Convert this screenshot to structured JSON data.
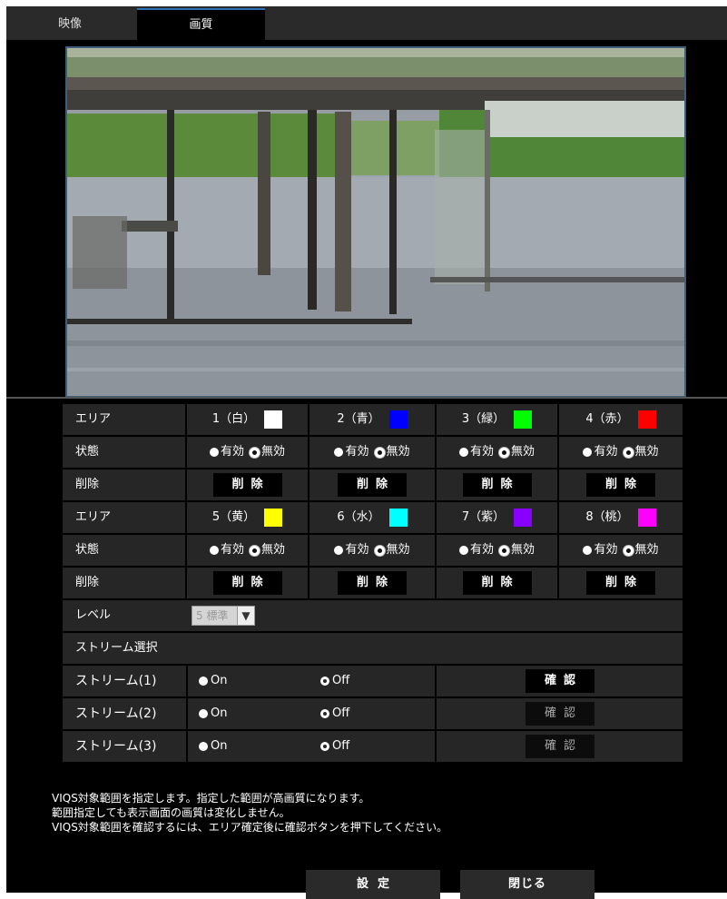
{
  "tabs": [
    {
      "label": "映像"
    },
    {
      "label": "画質"
    }
  ],
  "areas_row1": [
    {
      "label": "1（白）",
      "color": "#ffffff"
    },
    {
      "label": "2（青）",
      "color": "#0000ff"
    },
    {
      "label": "3（緑）",
      "color": "#00ff00"
    },
    {
      "label": "4（赤）",
      "color": "#ff0000"
    }
  ],
  "areas_row2": [
    {
      "label": "5（黄）",
      "color": "#ffff00"
    },
    {
      "label": "6（水）",
      "color": "#00ffff"
    },
    {
      "label": "7（紫）",
      "color": "#8800ff"
    },
    {
      "label": "8（桃）",
      "color": "#ff00ff"
    }
  ],
  "labels": {
    "area": "エリア",
    "state": "状態",
    "delete": "削除",
    "level": "レベル",
    "stream_select": "ストリーム選択"
  },
  "state_options": {
    "enabled": "有効",
    "disabled": "無効",
    "selected": "無効"
  },
  "delete_button": "削除",
  "level_select": {
    "value": "5 標準"
  },
  "streams": [
    {
      "label": "ストリーム(1)",
      "on": "On",
      "off": "Off",
      "selected": "Off",
      "confirm": "確認",
      "confirm_enabled": true
    },
    {
      "label": "ストリーム(2)",
      "on": "On",
      "off": "Off",
      "selected": "Off",
      "confirm": "確認",
      "confirm_enabled": false
    },
    {
      "label": "ストリーム(3)",
      "on": "On",
      "off": "Off",
      "selected": "Off",
      "confirm": "確認",
      "confirm_enabled": false
    }
  ],
  "notes": [
    "VIQS対象範囲を指定します。指定した範囲が高画質になります。",
    "範囲指定しても表示画面の画質は変化しません。",
    "VIQS対象範囲を確認するには、エリア確定後に確認ボタンを押下してください。"
  ],
  "buttons": {
    "set": "設定",
    "close": "閉じる"
  }
}
